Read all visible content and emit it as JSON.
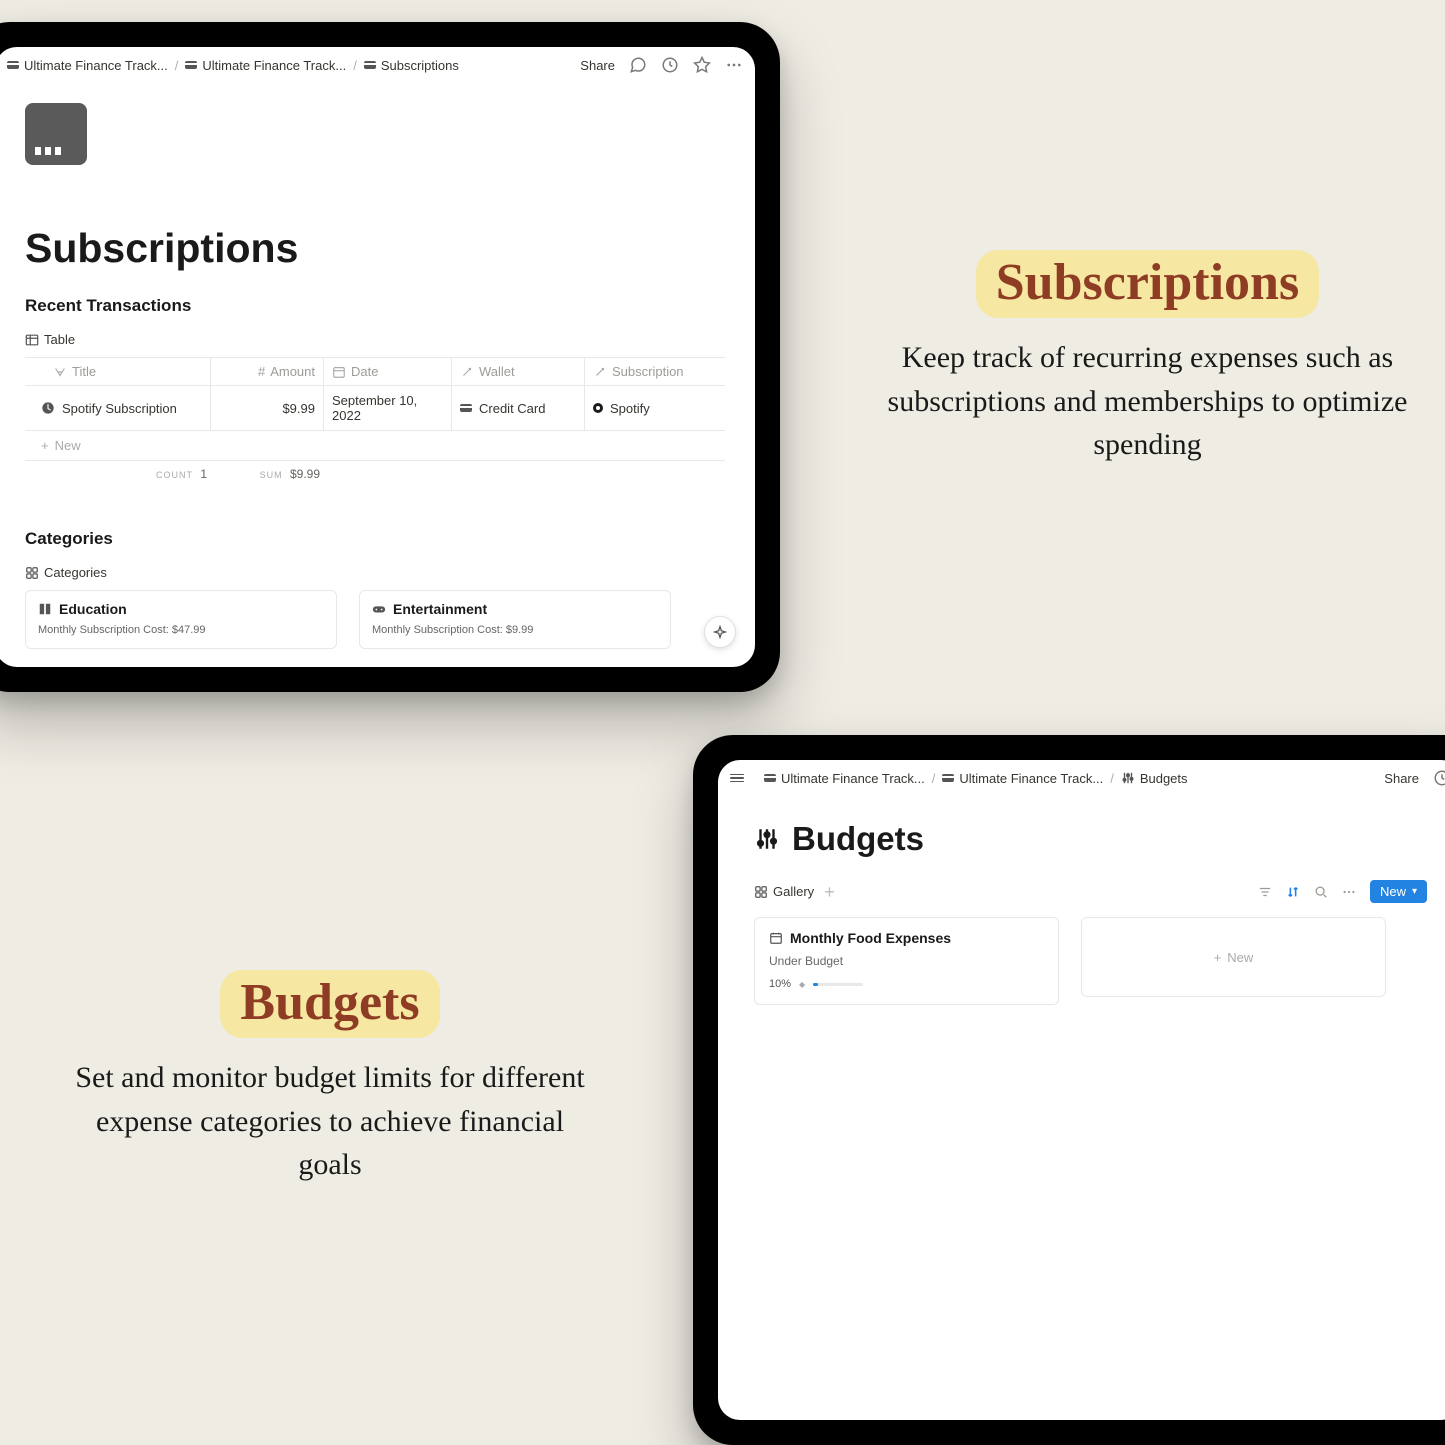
{
  "device1": {
    "breadcrumbs": [
      "Ultimate Finance Track...",
      "Ultimate Finance Track...",
      "Subscriptions"
    ],
    "share": "Share",
    "pageTitle": "Subscriptions",
    "section1": {
      "title": "Recent Transactions",
      "viewTab": "Table",
      "columns": [
        "Title",
        "Amount",
        "Date",
        "Wallet",
        "Subscription"
      ],
      "row": {
        "title": "Spotify Subscription",
        "amount": "$9.99",
        "date": "September 10, 2022",
        "wallet": "Credit Card",
        "subscription": "Spotify"
      },
      "newRow": "New",
      "footer": {
        "countLabel": "COUNT",
        "count": "1",
        "sumLabel": "SUM",
        "sum": "$9.99"
      }
    },
    "section2": {
      "title": "Categories",
      "viewTab": "Categories",
      "cards": [
        {
          "title": "Education",
          "sub": "Monthly Subscription Cost: $47.99"
        },
        {
          "title": "Entertainment",
          "sub": "Monthly Subscription Cost: $9.99"
        }
      ]
    }
  },
  "device2": {
    "breadcrumbs": [
      "Ultimate Finance Track...",
      "Ultimate Finance Track...",
      "Budgets"
    ],
    "share": "Share",
    "pageTitle": "Budgets",
    "view": {
      "tab": "Gallery",
      "newBtn": "New"
    },
    "card": {
      "title": "Monthly Food Expenses",
      "status": "Under Budget",
      "progress": "10%",
      "progressValue": 10
    },
    "emptyNew": "New"
  },
  "promo1": {
    "title": "Subscriptions",
    "body": "Keep track of recurring expenses such as subscriptions and memberships to optimize spending"
  },
  "promo2": {
    "title": "Budgets",
    "body": "Set and monitor budget limits for different expense categories to achieve financial goals"
  }
}
